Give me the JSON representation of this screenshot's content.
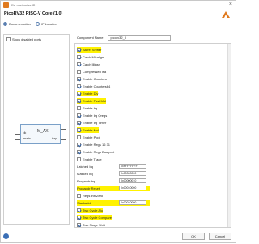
{
  "window": {
    "title": "Re-customize IP"
  },
  "app": {
    "title": "PicoRV32 RISC-V Core (1.0)"
  },
  "tabs": [
    {
      "label": "Documentation",
      "icon": "book-icon"
    },
    {
      "label": "IP Location",
      "icon": "folder-icon"
    }
  ],
  "left": {
    "show_pins_label": "Show disabled ports",
    "block_name": "M_AXI",
    "pins": {
      "clk": "clk",
      "resetn": "resetn",
      "trap": "trap"
    }
  },
  "right": {
    "component_name_label": "Component Name",
    "component_name_value": "picorv32_0",
    "options": [
      {
        "label": "Barrel Shifter",
        "checked": true,
        "highlight": true
      },
      {
        "label": "Catch Misalign",
        "checked": true,
        "highlight": false
      },
      {
        "label": "Catch Illinsn",
        "checked": true,
        "highlight": false
      },
      {
        "label": "Compressed Isa",
        "checked": false,
        "highlight": false
      },
      {
        "label": "Enable Counters",
        "checked": true,
        "highlight": false
      },
      {
        "label": "Enable Counters64",
        "checked": true,
        "highlight": false
      },
      {
        "label": "Enable Div",
        "checked": true,
        "highlight": true
      },
      {
        "label": "Enable Fast Mul",
        "checked": true,
        "highlight": true
      },
      {
        "label": "Enable Irq",
        "checked": false,
        "highlight": false
      },
      {
        "label": "Enable Irq Qregs",
        "checked": true,
        "highlight": false
      },
      {
        "label": "Enable Irq Timer",
        "checked": true,
        "highlight": false
      },
      {
        "label": "Enable Mul",
        "checked": true,
        "highlight": true
      },
      {
        "label": "Enable Pcpi",
        "checked": false,
        "highlight": false
      },
      {
        "label": "Enable Regs 16 31",
        "checked": true,
        "highlight": false
      },
      {
        "label": "Enable Regs Dualport",
        "checked": true,
        "highlight": false
      },
      {
        "label": "Enable Trace",
        "checked": false,
        "highlight": false
      }
    ],
    "fields": [
      {
        "label": "Latched Irq",
        "value": "0xFFFFFFFF",
        "highlight": false
      },
      {
        "label": "Masked Irq",
        "value": "0x00000000",
        "highlight": false
      },
      {
        "label": "Progaddr Irq",
        "value": "0x00000010",
        "highlight": false
      },
      {
        "label": "Progaddr Reset",
        "value": "0x00010000",
        "highlight": true
      }
    ],
    "regs_init": {
      "label": "Regs Init Zero",
      "checked": false
    },
    "stack_field": {
      "label": "Stackaddr",
      "value": "0x00010000",
      "highlight": true
    },
    "tail_options": [
      {
        "label": "Two Cycle Alu",
        "checked": true,
        "highlight": true
      },
      {
        "label": "Two Cycle Compare",
        "checked": true,
        "highlight": true
      },
      {
        "label": "Two Stage Shift",
        "checked": true,
        "highlight": false
      }
    ]
  },
  "footer": {
    "ok": "OK",
    "cancel": "Cancel"
  },
  "colors": {
    "highlight": "#fff200",
    "accent": "#3b6fb6"
  }
}
